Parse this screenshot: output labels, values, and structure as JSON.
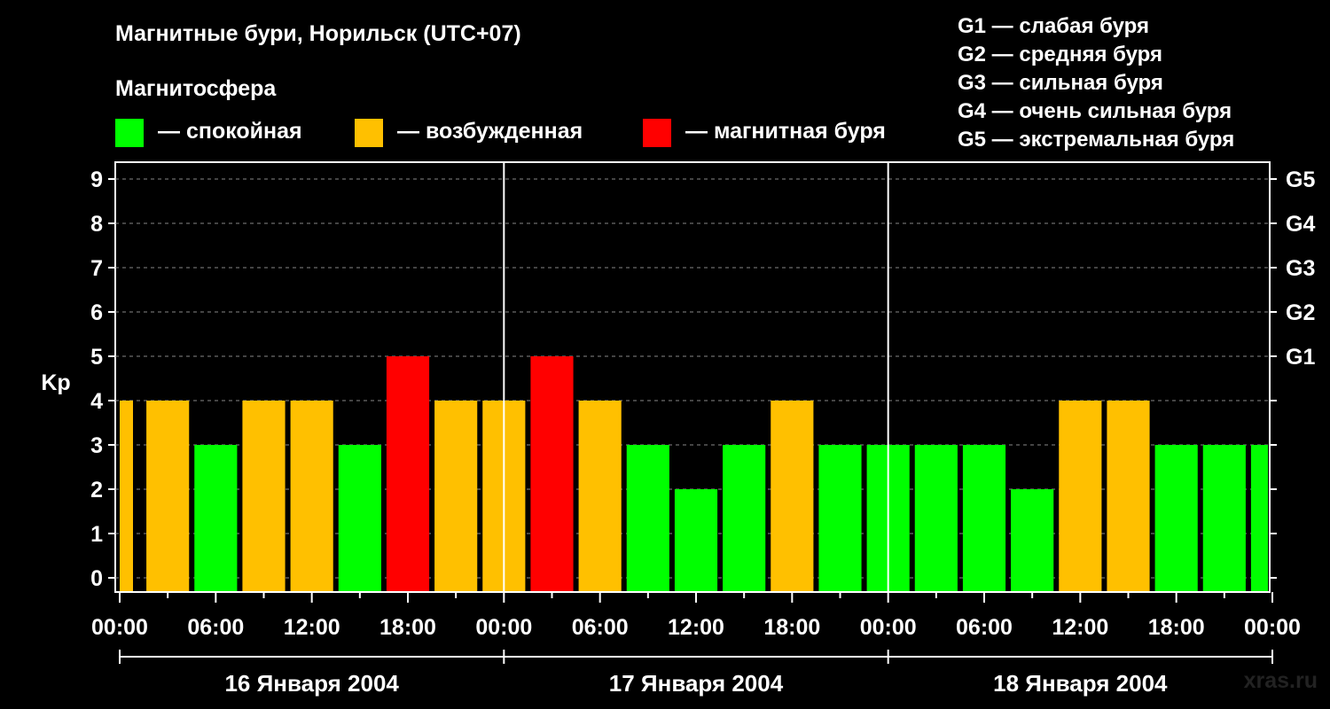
{
  "title": "Магнитные бури, Норильск (UTC+07)",
  "legend": {
    "heading": "Магнитосфера",
    "items": [
      {
        "label": "— спокойная",
        "color": "#00ff00"
      },
      {
        "label": "— возбужденная",
        "color": "#ffc000"
      },
      {
        "label": "— магнитная буря",
        "color": "#ff0000"
      }
    ]
  },
  "g_scale": [
    "G1 — слабая буря",
    "G2 — средняя буря",
    "G3 — сильная буря",
    "G4 — очень сильная буря",
    "G5 — экстремальная буря"
  ],
  "watermark": "xras.ru",
  "colors": {
    "quiet": "#00ff00",
    "active": "#ffc000",
    "storm": "#ff0000",
    "background": "#000000",
    "grid": "#888888"
  },
  "chart_data": {
    "type": "bar",
    "ylabel": "Kp",
    "xlabel": "",
    "ylim": [
      0,
      9
    ],
    "y_ticks": [
      "0",
      "1",
      "2",
      "3",
      "4",
      "5",
      "6",
      "7",
      "8",
      "9"
    ],
    "right_axis_labels": [
      {
        "kp": 5,
        "label": "G1"
      },
      {
        "kp": 6,
        "label": "G2"
      },
      {
        "kp": 7,
        "label": "G3"
      },
      {
        "kp": 8,
        "label": "G4"
      },
      {
        "kp": 9,
        "label": "G5"
      }
    ],
    "x_tick_labels": [
      "00:00",
      "06:00",
      "12:00",
      "18:00",
      "00:00",
      "06:00",
      "12:00",
      "18:00",
      "00:00",
      "06:00",
      "12:00",
      "18:00",
      "00:00"
    ],
    "day_labels": [
      "16 Января 2004",
      "17 Января 2004",
      "18 Января 2004"
    ],
    "interval_hours": 3,
    "values": [
      4,
      4,
      3,
      4,
      4,
      3,
      5,
      4,
      4,
      5,
      4,
      3,
      2,
      3,
      4,
      3,
      3,
      3,
      3,
      2,
      4,
      4,
      3,
      3,
      3
    ],
    "status": [
      "active",
      "active",
      "quiet",
      "active",
      "active",
      "quiet",
      "storm",
      "active",
      "active",
      "storm",
      "active",
      "quiet",
      "quiet",
      "quiet",
      "active",
      "quiet",
      "quiet",
      "quiet",
      "quiet",
      "quiet",
      "active",
      "active",
      "quiet",
      "quiet",
      "quiet"
    ],
    "grid": true,
    "legend_position": "top"
  }
}
